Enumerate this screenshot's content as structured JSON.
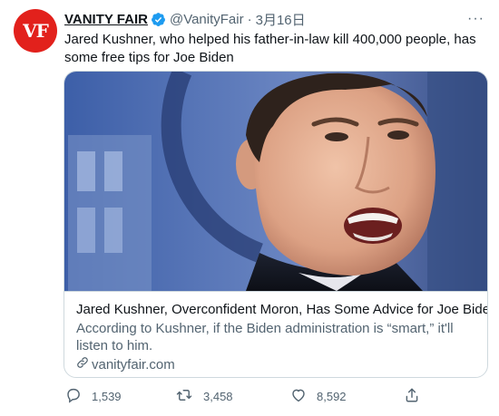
{
  "account": {
    "avatar_text": "VF",
    "name": "VANITY FAIR",
    "handle": "@VanityFair",
    "separator": "·",
    "date": "3月16日",
    "more_label": "···"
  },
  "tweet": {
    "text": "Jared Kushner, who helped his father-in-law kill 400,000 people, has some free tips for Joe Biden"
  },
  "card": {
    "title": "Jared Kushner, Overconfident Moron, Has Some Advice for Joe Biden",
    "description": "According to Kushner, if the Biden administration is “smart,” it'll listen to him.",
    "domain": "vanityfair.com"
  },
  "actions": {
    "reply_count": "1,539",
    "retweet_count": "3,458",
    "like_count": "8,592"
  },
  "colors": {
    "brand_red": "#e2211c",
    "verified_blue": "#1d9bf0",
    "secondary_text": "#536471",
    "border": "#cfd9de"
  }
}
